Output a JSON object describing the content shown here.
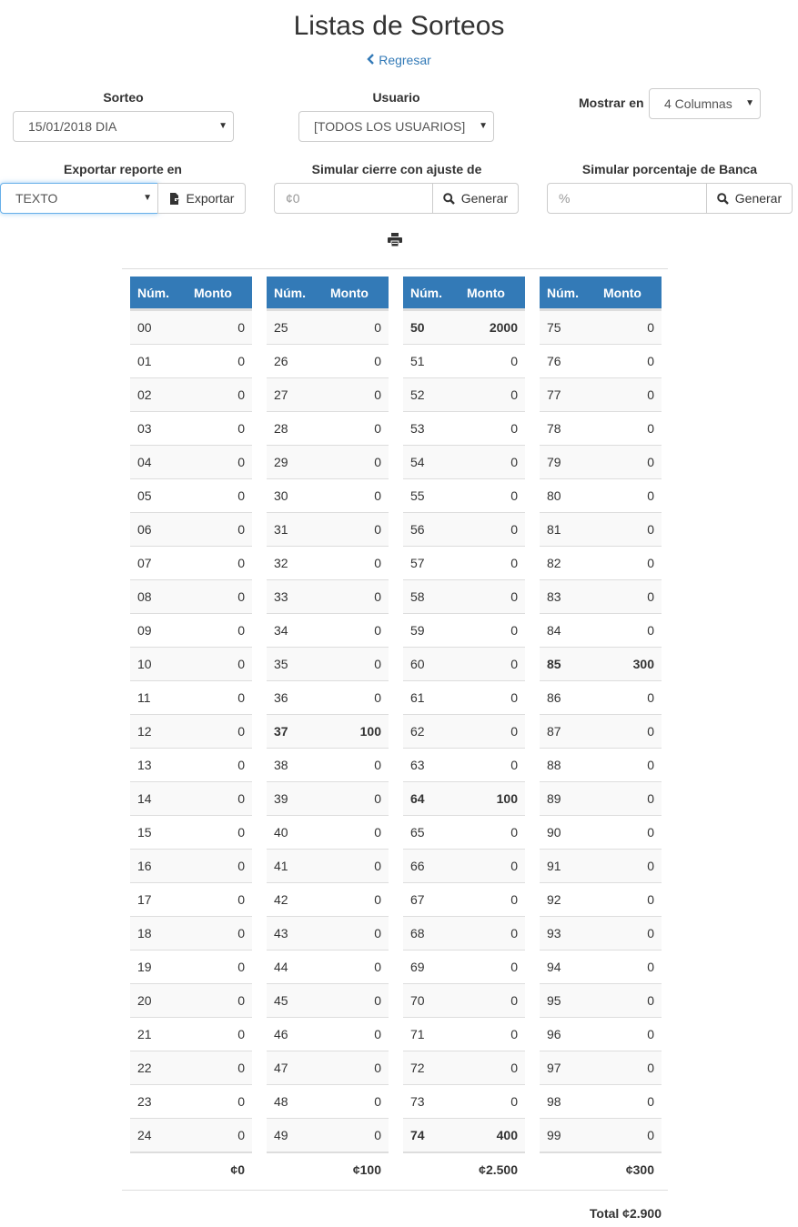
{
  "page": {
    "title": "Listas de Sorteos",
    "back_label": "Regresar"
  },
  "filters": {
    "sorteo_label": "Sorteo",
    "sorteo_value": "15/01/2018 DIA",
    "usuario_label": "Usuario",
    "usuario_value": "[TODOS LOS USUARIOS]",
    "mostrar_label": "Mostrar en",
    "mostrar_value": "4 Columnas",
    "exportar_label": "Exportar reporte en",
    "exportar_value": "TEXTO",
    "exportar_button": "Exportar",
    "cierre_label": "Simular cierre con ajuste de",
    "cierre_placeholder": "¢0",
    "cierre_button": "Generar",
    "banca_label": "Simular porcentaje de Banca",
    "banca_placeholder": "%",
    "banca_button": "Generar"
  },
  "table": {
    "header_num": "Núm.",
    "header_monto": "Monto",
    "columns": [
      {
        "rows": [
          {
            "num": "00",
            "monto": "0"
          },
          {
            "num": "01",
            "monto": "0"
          },
          {
            "num": "02",
            "monto": "0"
          },
          {
            "num": "03",
            "monto": "0"
          },
          {
            "num": "04",
            "monto": "0"
          },
          {
            "num": "05",
            "monto": "0"
          },
          {
            "num": "06",
            "monto": "0"
          },
          {
            "num": "07",
            "monto": "0"
          },
          {
            "num": "08",
            "monto": "0"
          },
          {
            "num": "09",
            "monto": "0"
          },
          {
            "num": "10",
            "monto": "0"
          },
          {
            "num": "11",
            "monto": "0"
          },
          {
            "num": "12",
            "monto": "0"
          },
          {
            "num": "13",
            "monto": "0"
          },
          {
            "num": "14",
            "monto": "0"
          },
          {
            "num": "15",
            "monto": "0"
          },
          {
            "num": "16",
            "monto": "0"
          },
          {
            "num": "17",
            "monto": "0"
          },
          {
            "num": "18",
            "monto": "0"
          },
          {
            "num": "19",
            "monto": "0"
          },
          {
            "num": "20",
            "monto": "0"
          },
          {
            "num": "21",
            "monto": "0"
          },
          {
            "num": "22",
            "monto": "0"
          },
          {
            "num": "23",
            "monto": "0"
          },
          {
            "num": "24",
            "monto": "0"
          }
        ],
        "subtotal": "¢0"
      },
      {
        "rows": [
          {
            "num": "25",
            "monto": "0"
          },
          {
            "num": "26",
            "monto": "0"
          },
          {
            "num": "27",
            "monto": "0"
          },
          {
            "num": "28",
            "monto": "0"
          },
          {
            "num": "29",
            "monto": "0"
          },
          {
            "num": "30",
            "monto": "0"
          },
          {
            "num": "31",
            "monto": "0"
          },
          {
            "num": "32",
            "monto": "0"
          },
          {
            "num": "33",
            "monto": "0"
          },
          {
            "num": "34",
            "monto": "0"
          },
          {
            "num": "35",
            "monto": "0"
          },
          {
            "num": "36",
            "monto": "0"
          },
          {
            "num": "37",
            "monto": "100",
            "bold": true
          },
          {
            "num": "38",
            "monto": "0"
          },
          {
            "num": "39",
            "monto": "0"
          },
          {
            "num": "40",
            "monto": "0"
          },
          {
            "num": "41",
            "monto": "0"
          },
          {
            "num": "42",
            "monto": "0"
          },
          {
            "num": "43",
            "monto": "0"
          },
          {
            "num": "44",
            "monto": "0"
          },
          {
            "num": "45",
            "monto": "0"
          },
          {
            "num": "46",
            "monto": "0"
          },
          {
            "num": "47",
            "monto": "0"
          },
          {
            "num": "48",
            "monto": "0"
          },
          {
            "num": "49",
            "monto": "0"
          }
        ],
        "subtotal": "¢100"
      },
      {
        "rows": [
          {
            "num": "50",
            "monto": "2000",
            "bold": true
          },
          {
            "num": "51",
            "monto": "0"
          },
          {
            "num": "52",
            "monto": "0"
          },
          {
            "num": "53",
            "monto": "0"
          },
          {
            "num": "54",
            "monto": "0"
          },
          {
            "num": "55",
            "monto": "0"
          },
          {
            "num": "56",
            "monto": "0"
          },
          {
            "num": "57",
            "monto": "0"
          },
          {
            "num": "58",
            "monto": "0"
          },
          {
            "num": "59",
            "monto": "0"
          },
          {
            "num": "60",
            "monto": "0"
          },
          {
            "num": "61",
            "monto": "0"
          },
          {
            "num": "62",
            "monto": "0"
          },
          {
            "num": "63",
            "monto": "0"
          },
          {
            "num": "64",
            "monto": "100",
            "bold": true
          },
          {
            "num": "65",
            "monto": "0"
          },
          {
            "num": "66",
            "monto": "0"
          },
          {
            "num": "67",
            "monto": "0"
          },
          {
            "num": "68",
            "monto": "0"
          },
          {
            "num": "69",
            "monto": "0"
          },
          {
            "num": "70",
            "monto": "0"
          },
          {
            "num": "71",
            "monto": "0"
          },
          {
            "num": "72",
            "monto": "0"
          },
          {
            "num": "73",
            "monto": "0"
          },
          {
            "num": "74",
            "monto": "400",
            "bold": true
          }
        ],
        "subtotal": "¢2.500"
      },
      {
        "rows": [
          {
            "num": "75",
            "monto": "0"
          },
          {
            "num": "76",
            "monto": "0"
          },
          {
            "num": "77",
            "monto": "0"
          },
          {
            "num": "78",
            "monto": "0"
          },
          {
            "num": "79",
            "monto": "0"
          },
          {
            "num": "80",
            "monto": "0"
          },
          {
            "num": "81",
            "monto": "0"
          },
          {
            "num": "82",
            "monto": "0"
          },
          {
            "num": "83",
            "monto": "0"
          },
          {
            "num": "84",
            "monto": "0"
          },
          {
            "num": "85",
            "monto": "300",
            "bold": true
          },
          {
            "num": "86",
            "monto": "0"
          },
          {
            "num": "87",
            "monto": "0"
          },
          {
            "num": "88",
            "monto": "0"
          },
          {
            "num": "89",
            "monto": "0"
          },
          {
            "num": "90",
            "monto": "0"
          },
          {
            "num": "91",
            "monto": "0"
          },
          {
            "num": "92",
            "monto": "0"
          },
          {
            "num": "93",
            "monto": "0"
          },
          {
            "num": "94",
            "monto": "0"
          },
          {
            "num": "95",
            "monto": "0"
          },
          {
            "num": "96",
            "monto": "0"
          },
          {
            "num": "97",
            "monto": "0"
          },
          {
            "num": "98",
            "monto": "0"
          },
          {
            "num": "99",
            "monto": "0"
          }
        ],
        "subtotal": "¢300"
      }
    ],
    "total": "Total ¢2.900"
  },
  "colors": {
    "header_bg": "#337ab7",
    "link": "#337ab7",
    "striped_row": "#f9f9f9",
    "focus_border": "#66afe9"
  },
  "icons": {
    "back": "chevron-left-icon",
    "export": "file-export-icon",
    "search": "search-icon",
    "print": "printer-icon"
  }
}
